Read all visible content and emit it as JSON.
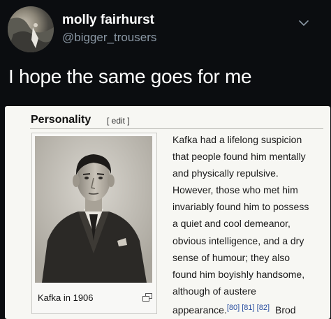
{
  "tweet": {
    "display_name": "molly fairhurst",
    "handle": "@bigger_trousers",
    "text": "I hope the same goes for me",
    "menu_icon": "chevron-down-icon"
  },
  "wiki": {
    "heading": "Personality",
    "edit_link": "[ edit ]",
    "image_caption": "Kafka in 1906",
    "enlarge_icon": "enlarge-icon",
    "body_lines": [
      "Kafka had a lifelong suspicion",
      "that people found him mentally",
      "and physically repulsive.",
      "However, those who met him",
      "invariably found him to possess",
      "a quiet and cool demeanor,",
      "obvious intelligence, and a dry",
      "sense of humour; they also",
      "found him boyishly handsome,",
      "although of austere"
    ],
    "last_line_text": "appearance.",
    "references": "[80] [81] [82]",
    "trailing_word": "Brod"
  }
}
